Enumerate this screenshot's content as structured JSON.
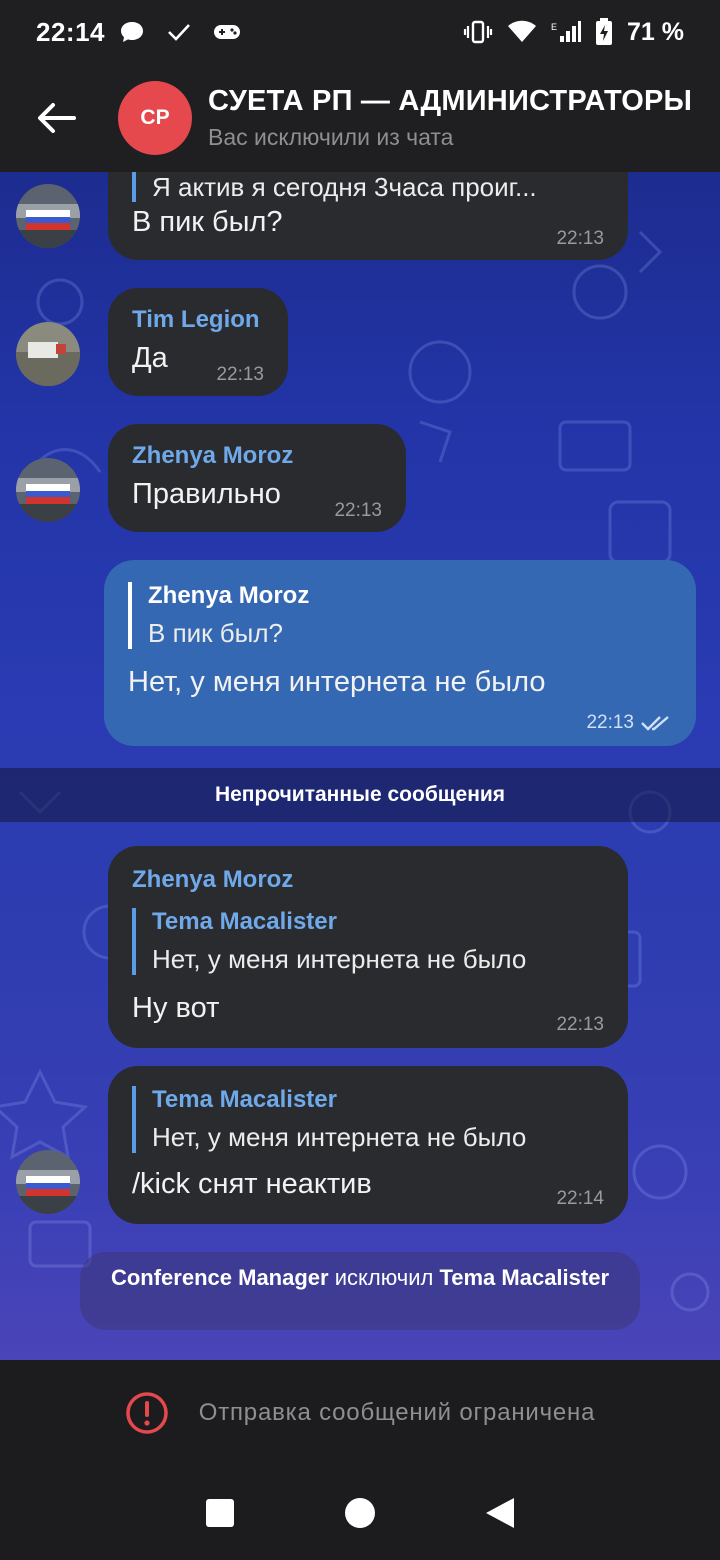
{
  "status_bar": {
    "time": "22:14",
    "battery": "71 %",
    "icons": [
      "chat-bubble-icon",
      "check-icon",
      "gamepad-icon",
      "vibrate-icon",
      "wifi-icon",
      "signal-icon",
      "battery-icon"
    ]
  },
  "header": {
    "avatar_initials": "СР",
    "title": "СУЕТА РП — АДМИНИСТРАТОРЫ",
    "subtitle": "Вас исключили из чата",
    "avatar_color": "#e5484d"
  },
  "messages": [
    {
      "reply_text": "Я актив я сегодня 3часа проиг...",
      "text": "В пик был?",
      "time": "22:13"
    },
    {
      "sender": "Tim Legion",
      "text": "Да",
      "time": "22:13"
    },
    {
      "sender": "Zhenya Moroz",
      "text": "Правильно",
      "time": "22:13"
    },
    {
      "reply_name": "Zhenya Moroz",
      "reply_text": "В пик был?",
      "text": "Нет, у меня интернета не было",
      "time": "22:13"
    },
    {
      "sender": "Zhenya Moroz",
      "reply_name": "Tema Macalister",
      "reply_text": "Нет, у меня интернета не было",
      "text": "Ну вот",
      "time": "22:13"
    },
    {
      "reply_name": "Tema Macalister",
      "reply_text": "Нет, у меня интернета не было",
      "text": "/kick снят неактив",
      "time": "22:14"
    }
  ],
  "unread_label": "Непрочитанные сообщения",
  "service_message": {
    "actor": "Conference Manager",
    "action": "исключил",
    "target": "Tema Macalister"
  },
  "footer": {
    "restricted_text": "Отправка сообщений ограничена"
  },
  "colors": {
    "accent": "#6fa9ea",
    "outgoing_bubble": "#3568b2",
    "incoming_bubble": "#2a2b2e",
    "warning": "#e5484d"
  }
}
